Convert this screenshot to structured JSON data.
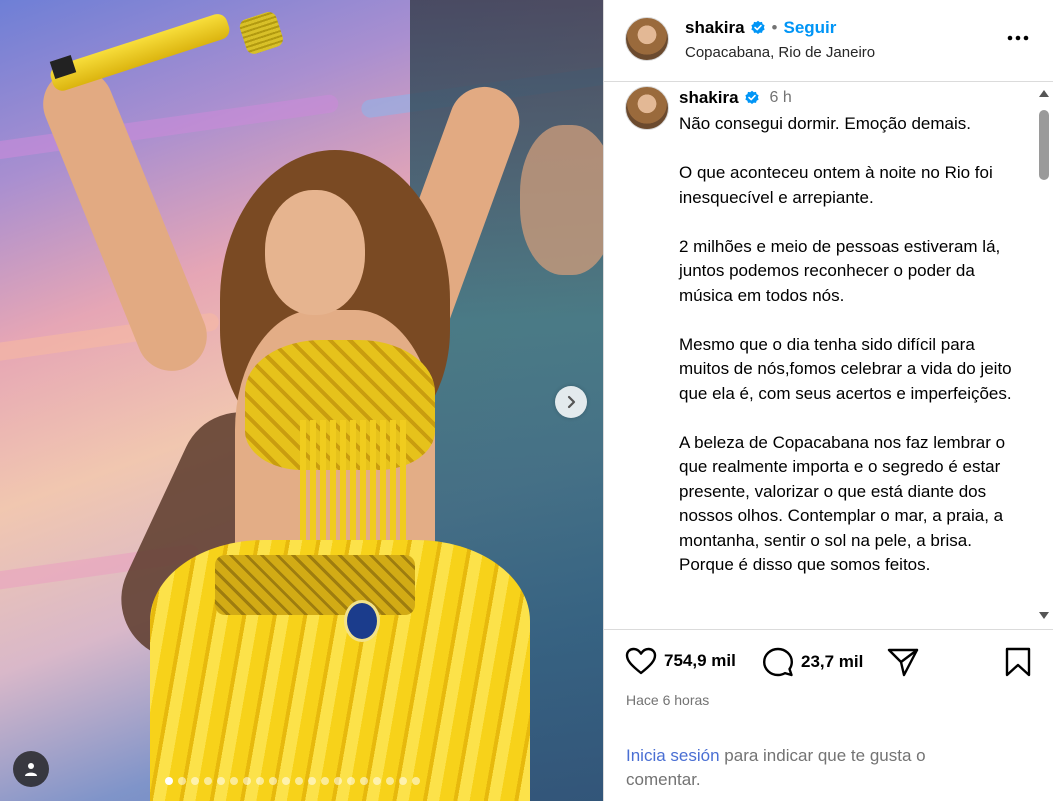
{
  "post": {
    "username": "shakira",
    "follow_label": "Seguir",
    "separator": "•",
    "location": "Copacabana, Rio de Janeiro",
    "more_label": "•••"
  },
  "caption": {
    "username": "shakira",
    "time": "6 h",
    "text": "Não consegui dormir. Emoção demais.\n\nO que aconteceu ontem à noite no Rio foi inesquecível e arrepiante.\n\n2 milhões e meio de pessoas estiveram lá, juntos podemos reconhecer o poder da música em todos nós.\n\nMesmo que o dia tenha sido difícil para muitos de nós,fomos celebrar a vida do jeito que ela é, com seus acertos e imperfeições.\n\nA beleza de Copacabana nos faz lembrar o que realmente importa e o segredo é estar presente, valorizar o que está diante dos nossos olhos. Contemplar o mar, a praia, a montanha, sentir o sol na pele, a brisa. Porque é disso que somos feitos."
  },
  "stats": {
    "likes": "754,9 mil",
    "comments": "23,7 mil",
    "posted_ago": "Hace 6 horas"
  },
  "login_prompt": {
    "link": "Inicia sesión",
    "rest": " para indicar que te gusta o comentar."
  },
  "carousel": {
    "total_slides": 20,
    "active_index": 0
  },
  "icons": {
    "verified": "verified-badge-icon",
    "next": "chevron-right-icon",
    "like": "heart-icon",
    "comment": "comment-bubble-icon",
    "share": "paper-plane-icon",
    "save": "bookmark-icon",
    "tag": "user-tag-icon"
  },
  "colors": {
    "accent": "#0095f6",
    "link": "#4a6fd3",
    "muted": "#737373"
  }
}
